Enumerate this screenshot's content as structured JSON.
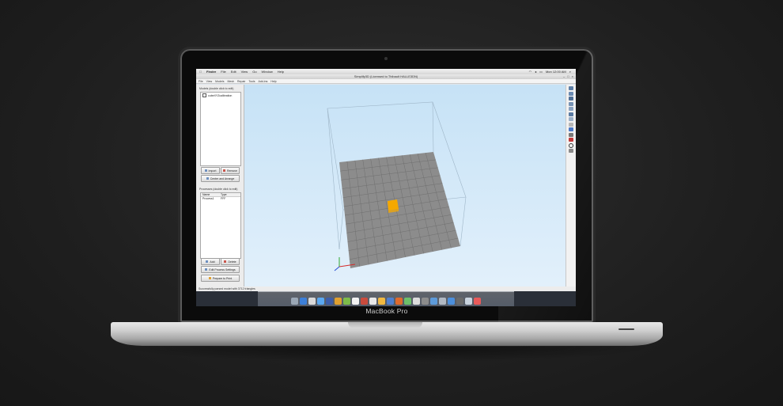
{
  "device": {
    "model_label": "MacBook Pro"
  },
  "mac_menubar": {
    "apple": "",
    "app": "Finder",
    "items": [
      "File",
      "Edit",
      "View",
      "Go",
      "Window",
      "Help"
    ],
    "clock": "Mon 12:00 AM"
  },
  "window": {
    "title": "Simplify3D (Licensed to Thibault HALLE3DN)",
    "controls": [
      "–",
      "□",
      "×"
    ]
  },
  "app_menubar": {
    "items": [
      "File",
      "View",
      "Models",
      "Mesh",
      "Repair",
      "Tools",
      "Add-ins",
      "Help"
    ]
  },
  "models_panel": {
    "label": "Models (double click to edit)",
    "items": [
      {
        "name": "cubeXYZcalibration",
        "checked": true
      }
    ],
    "import_label": "Import",
    "remove_label": "Remove",
    "center_label": "Center and Arrange"
  },
  "processes_panel": {
    "label": "Processes (double click to edit)",
    "columns": [
      "Name",
      "Type"
    ],
    "rows": [
      {
        "name": "Process1",
        "type": "FFF"
      }
    ],
    "add_label": "Add",
    "delete_label": "Delete",
    "edit_settings_label": "Edit Process Settings",
    "prepare_label": "Prepare to Print"
  },
  "viewport": {
    "bed_color": "#8c8c8c",
    "grid_color": "#6f6f6f",
    "part_color": "#f5a800",
    "background_top": "#c6e2f6",
    "background_bottom": "#e2f0fb"
  },
  "toolbar_icons": [
    "view-iso-icon",
    "view-front-icon",
    "view-back-icon",
    "view-left-icon",
    "view-right-icon",
    "view-top-icon",
    "view-bottom-icon",
    "cross-section-icon",
    "move-icon",
    "measure-icon",
    "color-icon",
    "circle-icon",
    "settings-icon"
  ],
  "status_text": "Successfully parsed model with 3712 triangles",
  "dock_icon_colors": [
    "#9aa7b5",
    "#3c7fd8",
    "#d9d9d9",
    "#5ba8f0",
    "#3d5da8",
    "#e0a030",
    "#7dbb4a",
    "#f2f2f2",
    "#c94b3d",
    "#e8e8e8",
    "#f0b840",
    "#4f7fcf",
    "#e06a2c",
    "#6dbf6a",
    "#dcdcdc",
    "#8c8c8c",
    "#5d9ad9",
    "#b0b8c2",
    "#4c8fdc",
    "#6a6a6a",
    "#c9d3de",
    "#e85a5a"
  ]
}
